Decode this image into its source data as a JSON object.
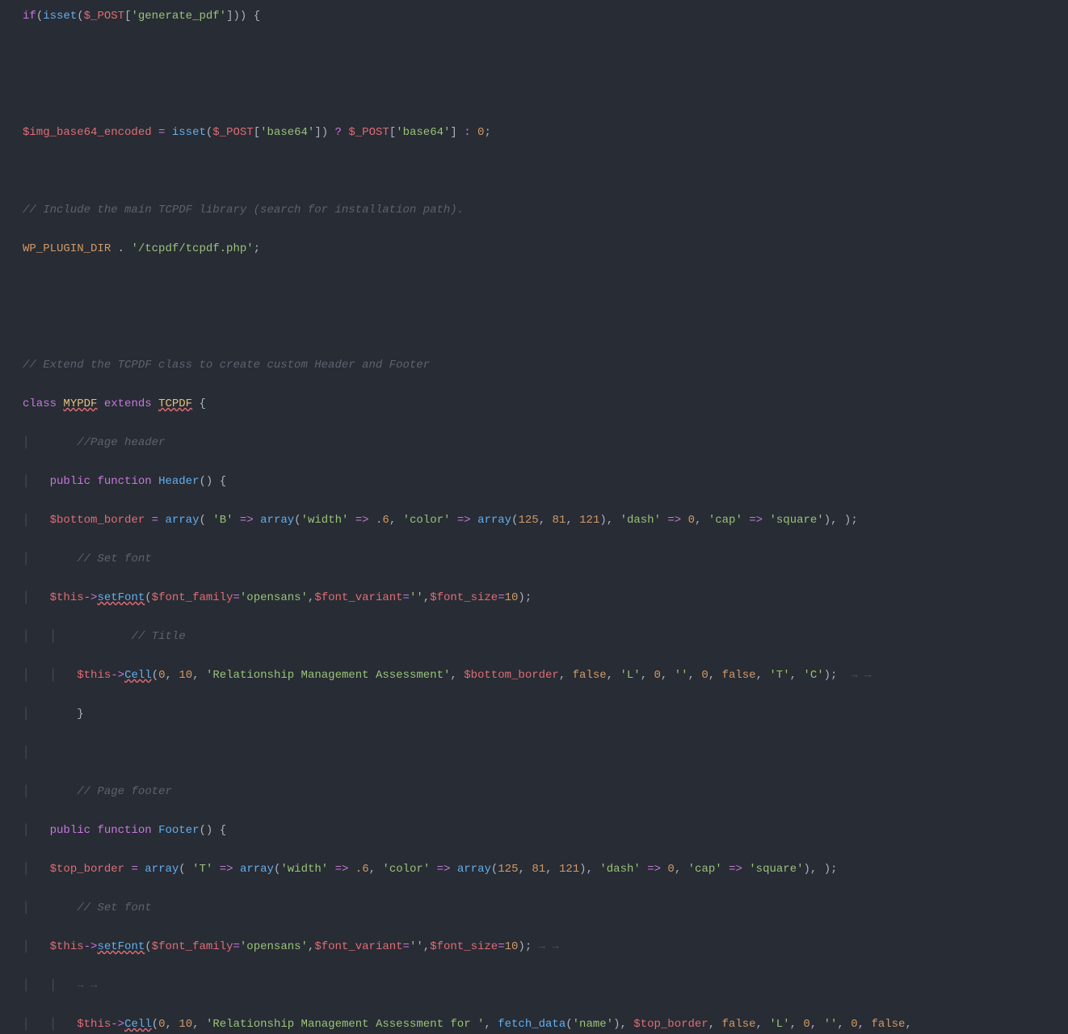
{
  "lines": {
    "l1": {
      "if": "if",
      "op1": "(",
      "isset": "isset",
      "op2": "(",
      "var": "$_POST",
      "op3": "[",
      "str": "'generate_pdf'",
      "op4": "]",
      "op5": ")",
      "op6": ")",
      "sp": " ",
      "br": "{"
    },
    "l2": "",
    "l3": "",
    "l4": {
      "var1": "$img_base64_encoded",
      "sp1": " ",
      "eq": "=",
      "sp2": " ",
      "isset": "isset",
      "op1": "(",
      "var2": "$_POST",
      "op2": "[",
      "str1": "'base64'",
      "op3": "]",
      "op4": ")",
      "sp3": " ",
      "q": "?",
      "sp4": " ",
      "var3": "$_POST",
      "op5": "[",
      "str2": "'base64'",
      "op6": "]",
      "sp5": " ",
      "col": ":",
      "sp6": " ",
      "zero": "0",
      "semi": ";"
    },
    "l5": "",
    "l6": "// Include the main TCPDF library (search for installation path).",
    "l7": {
      "const": "WP_PLUGIN_DIR",
      "sp1": " ",
      "dot": ".",
      "sp2": " ",
      "str": "'/tcpdf/tcpdf.php'",
      "semi": ";"
    },
    "l8": "",
    "l9": "",
    "l10": "// Extend the TCPDF class to create custom Header and Footer",
    "l11": {
      "kw1": "class",
      "sp1": " ",
      "cls1": "MYPDF",
      "sp2": " ",
      "kw2": "extends",
      "sp3": " ",
      "cls2": "TCPDF",
      "sp4": " ",
      "br": "{"
    },
    "l12": "    //Page header",
    "l13": {
      "ind": "    ",
      "kw1": "public",
      "sp1": " ",
      "kw2": "function",
      "sp2": " ",
      "fn": "Header",
      "op1": "(",
      "op2": ")",
      "sp3": " ",
      "br": "{"
    },
    "l14": {
      "ind": "    ",
      "var1": "$bottom_border",
      "sp1": " ",
      "eq": "=",
      "sp2": " ",
      "arr1": "array",
      "op1": "(",
      "sp3": " ",
      "str1": "'B'",
      "sp4": " ",
      "ar1": "=>",
      "sp5": " ",
      "arr2": "array",
      "op2": "(",
      "str2": "'width'",
      "sp6": " ",
      "ar2": "=>",
      "sp7": " ",
      "num1": ".6",
      "cm1": ",",
      "sp8": " ",
      "str3": "'color'",
      "sp9": " ",
      "ar3": "=>",
      "sp10": " ",
      "arr3": "array",
      "op3": "(",
      "num2": "125",
      "cm2": ",",
      "sp11": " ",
      "num3": "81",
      "cm3": ",",
      "sp12": " ",
      "num4": "121",
      "op4": ")",
      "cm4": ",",
      "sp13": " ",
      "str4": "'dash'",
      "sp14": " ",
      "ar4": "=>",
      "sp15": " ",
      "num5": "0",
      "cm5": ",",
      "sp16": " ",
      "str5": "'cap'",
      "sp17": " ",
      "ar5": "=>",
      "sp18": " ",
      "str6": "'square'",
      "op5": ")",
      "cm6": ",",
      "sp19": " ",
      "op6": ")",
      "semi": ";"
    },
    "l15": "    // Set font",
    "l16": {
      "ind": "    ",
      "var1": "$this",
      "arrw": "->",
      "fn": "setFont",
      "op1": "(",
      "var2": "$font_family",
      "eq1": "=",
      "str1": "'opensans'",
      "cm1": ",",
      "var3": "$font_variant",
      "eq2": "=",
      "str2": "''",
      "cm2": ",",
      "var4": "$font_size",
      "eq3": "=",
      "num": "10",
      "op2": ")",
      "semi": ";"
    },
    "l17": "        // Title",
    "l18": {
      "ind": "        ",
      "var": "$this",
      "arrw": "->",
      "fn": "Cell",
      "op1": "(",
      "n1": "0",
      "c1": ",",
      "s1": " ",
      "n2": "10",
      "c2": ",",
      "s2": " ",
      "str1": "'Relationship Management Assessment'",
      "c3": ",",
      "s3": " ",
      "var2": "$bottom_border",
      "c4": ",",
      "s4": " ",
      "b1": "false",
      "c5": ",",
      "s5": " ",
      "str2": "'L'",
      "c6": ",",
      "s6": " ",
      "n3": "0",
      "c7": ",",
      "s7": " ",
      "str3": "''",
      "c8": ",",
      "s8": " ",
      "n4": "0",
      "c9": ",",
      "s9": " ",
      "b2": "false",
      "c10": ",",
      "s10": " ",
      "str4": "'T'",
      "c11": ",",
      "s11": " ",
      "str5": "'C'",
      "op2": ")",
      "semi": ";"
    },
    "l19": "    }",
    "l20": "",
    "l21": "    // Page footer",
    "l22": {
      "ind": "    ",
      "kw1": "public",
      "sp1": " ",
      "kw2": "function",
      "sp2": " ",
      "fn": "Footer",
      "op1": "(",
      "op2": ")",
      "sp3": " ",
      "br": "{"
    },
    "l23": {
      "ind": "    ",
      "var1": "$top_border",
      "sp1": " ",
      "eq": "=",
      "sp2": " ",
      "arr1": "array",
      "op1": "(",
      "sp3": " ",
      "str1": "'T'",
      "sp4": " ",
      "ar1": "=>",
      "sp5": " ",
      "arr2": "array",
      "op2": "(",
      "str2": "'width'",
      "sp6": " ",
      "ar2": "=>",
      "sp7": " ",
      "num1": ".6",
      "cm1": ",",
      "sp8": " ",
      "str3": "'color'",
      "sp9": " ",
      "ar3": "=>",
      "sp10": " ",
      "arr3": "array",
      "op3": "(",
      "num2": "125",
      "cm2": ",",
      "sp11": " ",
      "num3": "81",
      "cm3": ",",
      "sp12": " ",
      "num4": "121",
      "op4": ")",
      "cm4": ",",
      "sp13": " ",
      "str4": "'dash'",
      "sp14": " ",
      "ar4": "=>",
      "sp15": " ",
      "num5": "0",
      "cm5": ",",
      "sp16": " ",
      "str5": "'cap'",
      "sp17": " ",
      "ar5": "=>",
      "sp18": " ",
      "str6": "'square'",
      "op5": ")",
      "cm6": ",",
      "sp19": " ",
      "op6": ")",
      "semi": ";"
    },
    "l24": "    // Set font",
    "l25": {
      "ind": "    ",
      "var1": "$this",
      "arrw": "->",
      "fn": "setFont",
      "op1": "(",
      "var2": "$font_family",
      "eq1": "=",
      "str1": "'opensans'",
      "cm1": ",",
      "var3": "$font_variant",
      "eq2": "=",
      "str2": "''",
      "cm2": ",",
      "var4": "$font_size",
      "eq3": "=",
      "num": "10",
      "op2": ")",
      "semi": ";"
    },
    "l26": "",
    "l27": {
      "ind": "        ",
      "var": "$this",
      "arrw": "->",
      "fn": "Cell",
      "op1": "(",
      "n1": "0",
      "c1": ",",
      "s1": " ",
      "n2": "10",
      "c2": ",",
      "s2": " ",
      "str1": "'Relationship Management Assessment for '",
      "c3": ",",
      "s3": " ",
      "fn2": "fetch_data",
      "op2": "(",
      "str2": "'name'",
      "op3": ")",
      "c4": ",",
      "s4": " ",
      "var2": "$top_border",
      "c5": ",",
      "s5": " ",
      "b1": "false",
      "c6": ",",
      "s6": " ",
      "str3": "'L'",
      "c7": ",",
      "s7": " ",
      "n3": "0",
      "c8": ",",
      "s8": " ",
      "str4": "''",
      "c9": ",",
      "s9": " ",
      "n4": "0",
      "c10": ",",
      "s10": " ",
      "b2": "false",
      "c11": ","
    }
  },
  "guides": {
    "g1": "·",
    "g4": "····",
    "g8": "········",
    "pipe": "│",
    "arr": "→"
  }
}
